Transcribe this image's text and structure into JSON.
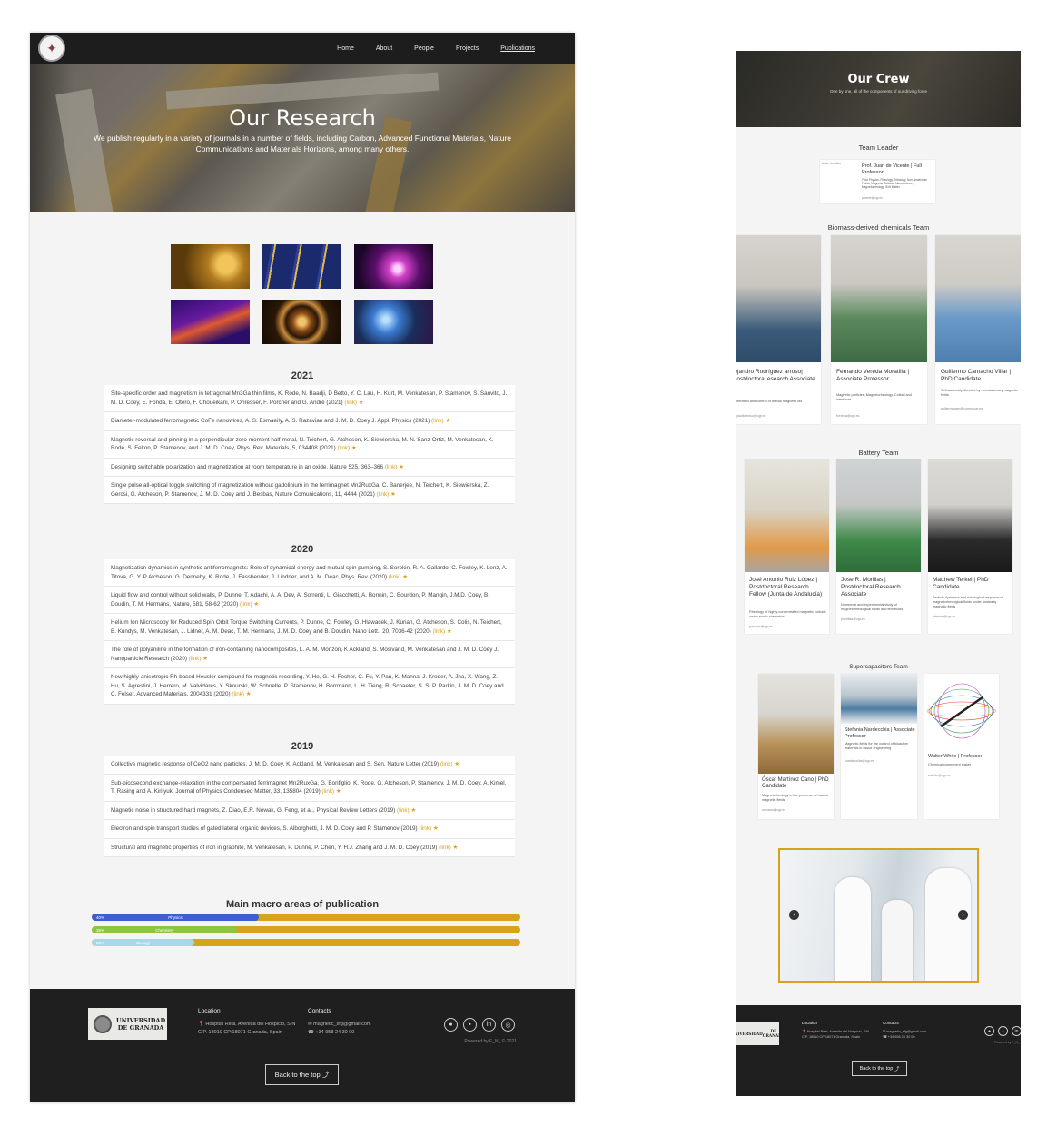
{
  "nav": {
    "items": [
      "Home",
      "About",
      "People",
      "Projects",
      "Publications"
    ],
    "active": "Publications"
  },
  "hero": {
    "title": "Our Research",
    "subtitle": "We publish regularly in a variety of journals in a number of fields, including Carbon, Advanced Functional Materials, Nature Communications and Materials Horizons, among many others."
  },
  "years": [
    {
      "year": "2021",
      "pubs": [
        "Site-specific order and magnetism in tetragonal Mn3Ga thin films, K. Rode, N. Baadji, D Betto, Y. C. Lau, H. Kurt, M. Venkatesan, P. Stamenov, S. Sanvito, J. M. D. Coey, E. Fonda, E. Otero, F. Choueikani, P. Ohresser, F. Porcher and G. André (2021)",
        "Diameter-modulated ferromagnetic CoFe nanowires, A. S. Esmaeily, A. S. Razavian and J. M. D. Coey J. Appl. Physics (2021)",
        "Magnetic reversal and pinning in a perpendicular zero-moment half-metal, N. Teichert, G. Atcheson, K. Siewierska, M. N. Sanz-Ortiz, M. Venkatesan, K. Rode, S. Felton, P. Stamenov, and J. M. D. Coey, Phys. Rev. Materials, 5, 034408 (2021)",
        "Designing switchable polarization and magnetization at room temperature in an oxide, Nature 525, 363–366",
        "Single pulse all-optical toggle switching of magnetization without gadolinium in the ferrimagnet Mn2RuxGa, C. Banerjee, N. Teichert, K. Siewierska, Z. Gercsi, G. Atcheson, P. Stamenov, J. M. D. Coey and J. Besbas, Nature Comunications, 11, 4444 (2021)"
      ]
    },
    {
      "year": "2020",
      "pubs": [
        "Magnetization dynamics in synthetic antiferromagnets: Role of dynamical energy and mutual spin pumping, S. Sorokin, R. A. Gallardo, C. Fowley, K. Lenz, A. Titova, G. Y. P Atcheson, G. Dennehy, K. Rode, J. Fassbender, J. Lindner, and A. M. Deac, Phys. Rev. (2020)",
        "Liquid flow and control without solid walls, P. Dunne, T. Adachi, A. A. Dev, A. Sorrenti, L. Giacchetti, A. Bonnin, C. Bourdon, P. Mangin, J.M.D. Coey, B. Doudin, T. M. Hermans, Nature, 581, 58-62 (2020)",
        "Helium Ion Microscopy for Reduced Spin Orbit Torque Switching Currents, P. Dunne, C. Fowley, G. Hlawacek, J. Kurian, G. Atcheson, S. Colis, N. Teichert, B. Kundys, M. Venkatesan, J. Lidner, A. M. Deac, T. M. Hermans, J. M. D. Coey and B. Doudin, Nano Lett., 20, 7036-42 (2020)",
        "The role of polyaniline in the formation of iron-containing nanocomposites, L. A. M. Monzon, K Ackland, S. Mosivand, M. Venkatesan and J. M. D. Coey J. Nanoparticle Research (2020)",
        "New highly-anisotropic Rh-based Heusler compound for magnetic recording, Y. He, G. H. Fecher, C. Fu, Y. Pan, K. Manna, J. Kroder, A. Jha, X. Wang, Z. Hu, S. Agrestini, J. Herrero, M. Valvidares, Y. Skourski, W. Schnelle, P. Stamenov, H. Borrmann, L. H. Tieng, R. Schaefer, S. S. P. Parkin, J. M. D. Coey and C. Felser, Advanced Materials, 2004331 (2020)"
      ]
    },
    {
      "year": "2019",
      "pubs": [
        "Collective magnetic response of CeO2 nano particles, J. M. D. Coey, K. Ackland, M. Venkatesan and S. Sen, Nature Letter (2019)",
        "Sub-picosecond exchange-relaxation in the compensated ferrimagnet Mn2RuxGa, G. Bonfiglio, K. Rode, G. Atcheson, P. Stamenov, J. M. D. Coey, A. Kimel, T. Rasing and A. Kirilyuk, Journal of Physics Condensed Matter, 33, 135804 (2019)",
        "Magnetic noise in structured hard magnets, Z. Diao, E.R. Nowak, G. Feng, et al., Physical Review Letters (2019)",
        "Electron and spin transport studies of gated lateral organic devices, S. Alborghetti, J. M. D. Coey and P. Stamenov (2019)",
        "Structural and magnetic properties of iron in graphite, M. Venkatesan, P. Dunne, P. Chen, Y. H.J. Zhang and J. M. D. Coey (2019)"
      ]
    }
  ],
  "link_text": "(link)",
  "link_star": "★",
  "areas": {
    "title": "Main macro areas of publication",
    "bars": [
      {
        "pct_label": "40%",
        "name": "Physics",
        "value": 0.39,
        "color": "#3b5fd0"
      },
      {
        "pct_label": "35%",
        "name": "Chemistry",
        "value": 0.34,
        "color": "#8cc63f"
      },
      {
        "pct_label": "25%",
        "name": "Biology",
        "value": 0.24,
        "color": "#a8d8e8"
      }
    ],
    "rest_color": "#d9a21d"
  },
  "footer": {
    "university_line1": "UNIVERSIDAD",
    "university_line2": "DE GRANADA",
    "location_head": "Location",
    "location_text": "Hospital Real, Avenida del Hospicio, S/N C.P. 18010 CP:18071 Granada, Spain",
    "contacts_head": "Contacts",
    "email": "magnetic_sfg@gmail.com",
    "phone": "+34 958 24 30 00",
    "powered": "Powered by F_N_ © 2021",
    "back_to_top": "Back to the top",
    "social_icons": [
      "github-icon",
      "twitter-icon",
      "linkedin-icon",
      "instagram-icon"
    ]
  },
  "crew": {
    "title": "Our Crew",
    "subtitle": "One by one, all of the components of our driving force",
    "team_leader_title": "Team Leader",
    "leader": {
      "img_alt": "team Leader",
      "name": "Prof. Juan de Vicente | Full Professor",
      "desc": "Fluid Physics, Rheology, Tribology, Non-Newtonian Fluids, Magnetic Colloids, Nanoscience, Magnetorheology, Soft Matter",
      "email": "jvicente@ugr.es"
    },
    "biomass_title": "Biomass-derived chemicals Team",
    "biomass": [
      {
        "name": "lejandro Rodríguez arroso| Postdoctoral esearch Associate",
        "desc": "neration and control of triaxial magnetic ids",
        "email": "yautbarroso@ugr.es"
      },
      {
        "name": "Fernando Vereda Moratilla | Associate Professor",
        "desc": "Magnetic particles, Magnetorheology, Colloid and interfaces",
        "email": "fvereda@ugr.es"
      },
      {
        "name": "Guillermo Camacho Villar | PhD Candidate",
        "desc": "Self-assembly directed by non-stationary magnetic fields",
        "email": "guillermocam@correo.ugr.es"
      }
    ],
    "battery_title": "Battery Team",
    "battery": [
      {
        "name": "José Antonio Ruiz López | Postdoctoral Research Fellow (Junta de Andalucía)",
        "desc": "Rheology of highly-concentrated magnetic colloids under exotic chematics",
        "email": "jarlopez@ugr.es"
      },
      {
        "name": "Jose R. Morillas | Postdoctoral Research Associate",
        "desc": "Numerical and experimental study of magnetorheological fluids and ferrofluids",
        "email": "jmorillas@ugr.es"
      },
      {
        "name": "Matthew Terkel | PhD Candidate",
        "desc": "Particle dynamics and rheological response of magnetorheological fluids under unsteady magnetic fields",
        "email": "mterkel@ugr.es"
      }
    ],
    "supercap_title": "Supercapacitors Team",
    "supercap": [
      {
        "name": "Óscar Martínez Cano | PhD Candidate",
        "desc": "Magnetorheology in the presence of triaxial magnetic fields",
        "email": "omcano@ugr.es"
      },
      {
        "name": "Stefania Nardecchia | Associate Professor",
        "desc": "Magnetic fields for the control of bioactive materials in tissue engineering",
        "email": "snardecchia@ugr.es"
      },
      {
        "name": "Walter White | Professor",
        "desc": "Chemical component maker",
        "email": "wwhite@ugr.es"
      }
    ]
  },
  "carousel": {
    "prev": "‹",
    "next": "›"
  }
}
